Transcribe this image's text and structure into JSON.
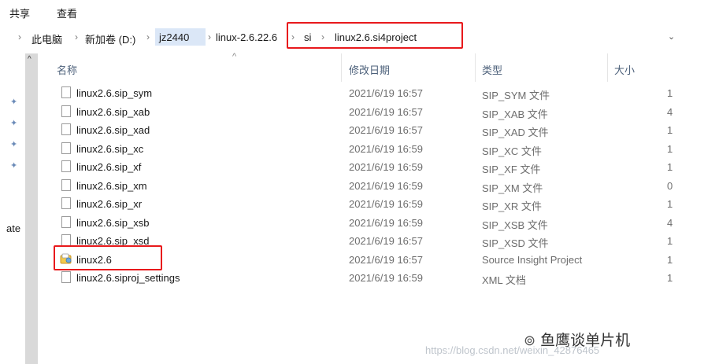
{
  "ribbon": {
    "share_label": "共享",
    "view_label": "查看"
  },
  "address": {
    "segments": [
      "此电脑",
      "新加卷 (D:)",
      "jz2440",
      "linux-2.6.22.6",
      "si",
      "linux2.6.si4project"
    ],
    "separator": "›",
    "lead_arrow": "›",
    "dropdown": "⌄"
  },
  "columns": {
    "name": "名称",
    "date": "修改日期",
    "type": "类型",
    "size": "大小"
  },
  "side": {
    "truncated_label": "ate"
  },
  "files": [
    {
      "name": "linux2.6.sip_sym",
      "date": "2021/6/19 16:57",
      "type": "SIP_SYM 文件",
      "size": "1",
      "icon": "blank-file-icon"
    },
    {
      "name": "linux2.6.sip_xab",
      "date": "2021/6/19 16:57",
      "type": "SIP_XAB 文件",
      "size": "4",
      "icon": "blank-file-icon"
    },
    {
      "name": "linux2.6.sip_xad",
      "date": "2021/6/19 16:57",
      "type": "SIP_XAD 文件",
      "size": "1",
      "icon": "blank-file-icon"
    },
    {
      "name": "linux2.6.sip_xc",
      "date": "2021/6/19 16:59",
      "type": "SIP_XC 文件",
      "size": "1",
      "icon": "blank-file-icon"
    },
    {
      "name": "linux2.6.sip_xf",
      "date": "2021/6/19 16:59",
      "type": "SIP_XF 文件",
      "size": "1",
      "icon": "blank-file-icon"
    },
    {
      "name": "linux2.6.sip_xm",
      "date": "2021/6/19 16:59",
      "type": "SIP_XM 文件",
      "size": "0",
      "icon": "blank-file-icon"
    },
    {
      "name": "linux2.6.sip_xr",
      "date": "2021/6/19 16:59",
      "type": "SIP_XR 文件",
      "size": "1",
      "icon": "blank-file-icon"
    },
    {
      "name": "linux2.6.sip_xsb",
      "date": "2021/6/19 16:59",
      "type": "SIP_XSB 文件",
      "size": "4",
      "icon": "blank-file-icon"
    },
    {
      "name": "linux2.6.sip_xsd",
      "date": "2021/6/19 16:57",
      "type": "SIP_XSD 文件",
      "size": "1",
      "icon": "blank-file-icon"
    },
    {
      "name": "linux2.6",
      "date": "2021/6/19 16:57",
      "type": "Source Insight Project",
      "size": "1",
      "icon": "source-insight-project-icon"
    },
    {
      "name": "linux2.6.siproj_settings",
      "date": "2021/6/19 16:59",
      "type": "XML 文档",
      "size": "1",
      "icon": "blank-file-icon"
    }
  ],
  "overlay": {
    "wechat_name": "鱼鹰谈单片机",
    "csdn_watermark": "https://blog.csdn.net/weixin_42876465"
  },
  "colors": {
    "highlight_box": "#e8191c",
    "header_text": "#4c607a",
    "meta_text": "#6d6d6d"
  }
}
